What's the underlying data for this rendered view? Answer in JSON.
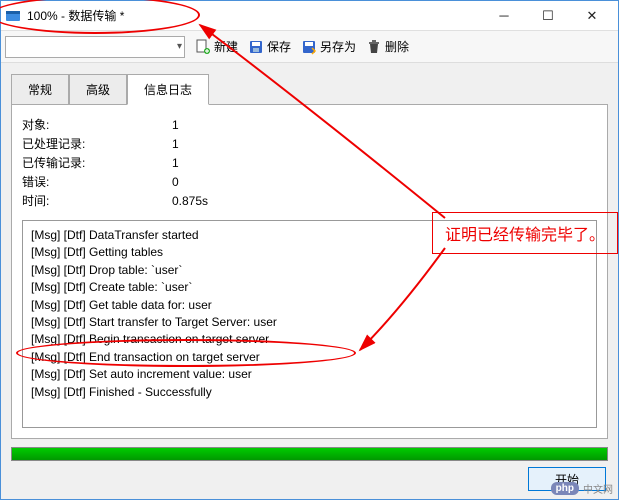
{
  "window": {
    "title": "100% - 数据传输 *"
  },
  "toolbar": {
    "new": "新建",
    "save": "保存",
    "saveas": "另存为",
    "delete": "删除"
  },
  "tabs": {
    "general": "常规",
    "advanced": "高级",
    "log": "信息日志"
  },
  "stats": {
    "object_label": "对象:",
    "object_val": "1",
    "processed_label": "已处理记录:",
    "processed_val": "1",
    "transferred_label": "已传输记录:",
    "transferred_val": "1",
    "errors_label": "错误:",
    "errors_val": "0",
    "time_label": "时间:",
    "time_val": "0.875s"
  },
  "log": [
    "[Msg] [Dtf] DataTransfer started",
    "[Msg] [Dtf] Getting tables",
    "[Msg] [Dtf] Drop table: `user`",
    "[Msg] [Dtf] Create table: `user`",
    "[Msg] [Dtf] Get table data for: user",
    "[Msg] [Dtf] Start transfer to Target Server: user",
    "[Msg] [Dtf] Begin transaction on target server",
    "[Msg] [Dtf] End transaction on target server",
    "[Msg] [Dtf] Set auto increment value: user",
    "[Msg] [Dtf] Finished - Successfully"
  ],
  "buttons": {
    "start": "开始"
  },
  "annotation": {
    "text": "证明已经传输完毕了。"
  },
  "watermark": {
    "brand": "php",
    "text": "中文网"
  }
}
